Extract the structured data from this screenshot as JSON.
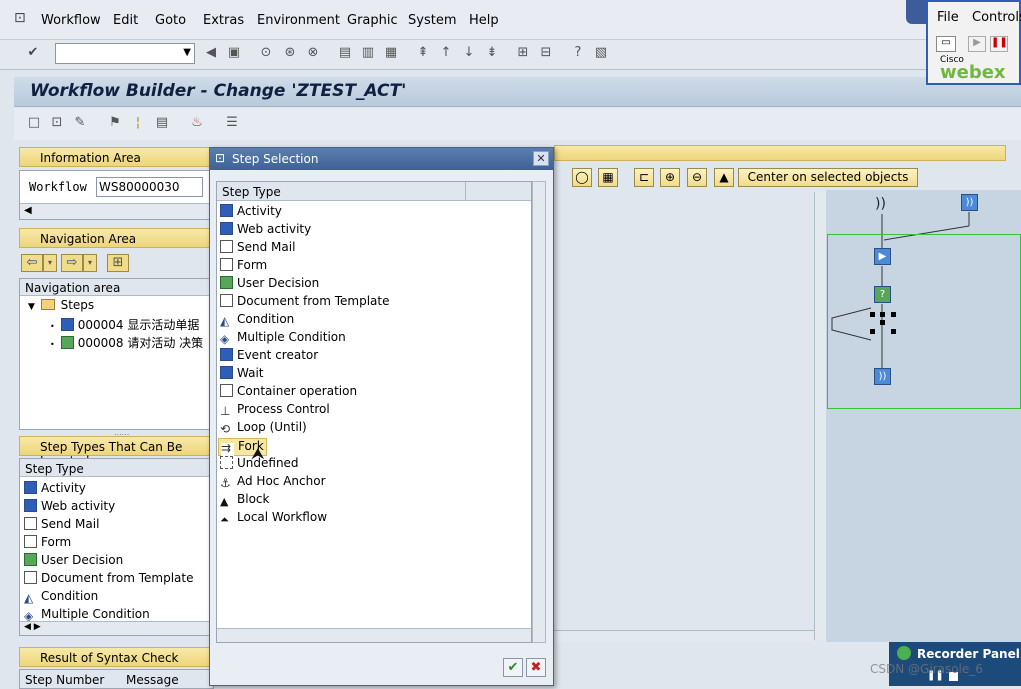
{
  "menu": {
    "items": [
      "Workflow",
      "Edit",
      "Goto",
      "Extras",
      "Environment",
      "Graphic",
      "System",
      "Help"
    ]
  },
  "title": "Workflow Builder - Change 'ZTEST_ACT'",
  "info_area": {
    "header": "Information Area",
    "workflow_label": "Workflow",
    "workflow_value": "WS80000030"
  },
  "nav_area": {
    "header": "Navigation Area",
    "column": "Navigation area",
    "root": "Steps",
    "steps": [
      {
        "id": "000004",
        "text": "显示活动单据"
      },
      {
        "id": "000008",
        "text": "请对活动 决策"
      }
    ]
  },
  "step_types_panel": {
    "header": "Step Types That Can Be Inserted",
    "column": "Step Type",
    "items": [
      "Activity",
      "Web activity",
      "Send Mail",
      "Form",
      "User Decision",
      "Document from Template",
      "Condition",
      "Multiple Condition"
    ]
  },
  "syntax": {
    "header": "Result of Syntax Check",
    "col_step": "Step Number",
    "col_msg": "Message"
  },
  "canvas": {
    "center_button": "Center on selected objects"
  },
  "dialog": {
    "title": "Step Selection",
    "column": "Step Type",
    "items": [
      "Activity",
      "Web activity",
      "Send Mail",
      "Form",
      "User Decision",
      "Document from Template",
      "Condition",
      "Multiple Condition",
      "Event creator",
      "Wait",
      "Container operation",
      "Process Control",
      "Loop (Until)",
      "Fork",
      "Undefined",
      "Ad Hoc Anchor",
      "Block",
      "Local Workflow"
    ],
    "hovered": "Fork"
  },
  "webex": {
    "menu_file": "File",
    "menu_controls": "Controls",
    "brand_small": "Cisco",
    "brand": "webex"
  },
  "recorder": {
    "label": "Recorder Panel"
  },
  "watermark": "CSDN @Girasole_6"
}
